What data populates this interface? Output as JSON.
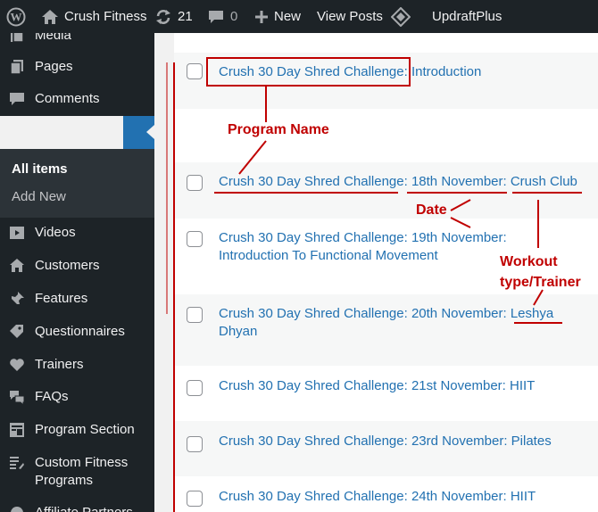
{
  "adminbar": {
    "wp_logo_icon": "wordpress-icon",
    "site_name": "Crush Fitness",
    "updates_count": "21",
    "comments_count": "0",
    "new_label": "New",
    "view_label": "View Posts",
    "updraft_label": "UpdraftPlus"
  },
  "sidebar": {
    "items": [
      {
        "label": "Media",
        "icon": "media-icon"
      },
      {
        "label": "Pages",
        "icon": "pages-icon"
      },
      {
        "label": "Comments",
        "icon": "comments-icon"
      },
      {
        "label": "Videos",
        "icon": "videos-icon"
      },
      {
        "label": "Customers",
        "icon": "customers-icon"
      },
      {
        "label": "Features",
        "icon": "pin-icon"
      },
      {
        "label": "Questionnaires",
        "icon": "tag-icon"
      },
      {
        "label": "Trainers",
        "icon": "heart-icon"
      },
      {
        "label": "FAQs",
        "icon": "faqs-icon"
      },
      {
        "label": "Program Section",
        "icon": "program-section-icon"
      },
      {
        "label": "Custom Fitness Programs",
        "icon": "custom-programs-icon"
      },
      {
        "label": "Affiliate Partners",
        "icon": "affiliate-icon"
      }
    ],
    "submenu": {
      "all_items": "All items",
      "add_new": "Add New"
    }
  },
  "list": {
    "rows": [
      {
        "title": "Crush 30 Day Shred Challenge: Introduction"
      },
      {
        "title": "Crush 30 Day Shred Challenge: 18th November: Crush Club"
      },
      {
        "title": "Crush 30 Day Shred Challenge: 19th November: Introduction To Functional Movement"
      },
      {
        "title": "Crush 30 Day Shred Challenge: 20th November: Leshya Dhyan"
      },
      {
        "title": "Crush 30 Day Shred Challenge: 21st November: HIIT"
      },
      {
        "title": "Crush 30 Day Shred Challenge: 23rd November: Pilates"
      },
      {
        "title": "Crush 30 Day Shred Challenge: 24th November: HIIT"
      }
    ]
  },
  "annotations": {
    "program_name": "Program Name",
    "date": "Date",
    "workout": "Workout",
    "type_trainer": "type/Trainer",
    "color": "#c00000"
  }
}
